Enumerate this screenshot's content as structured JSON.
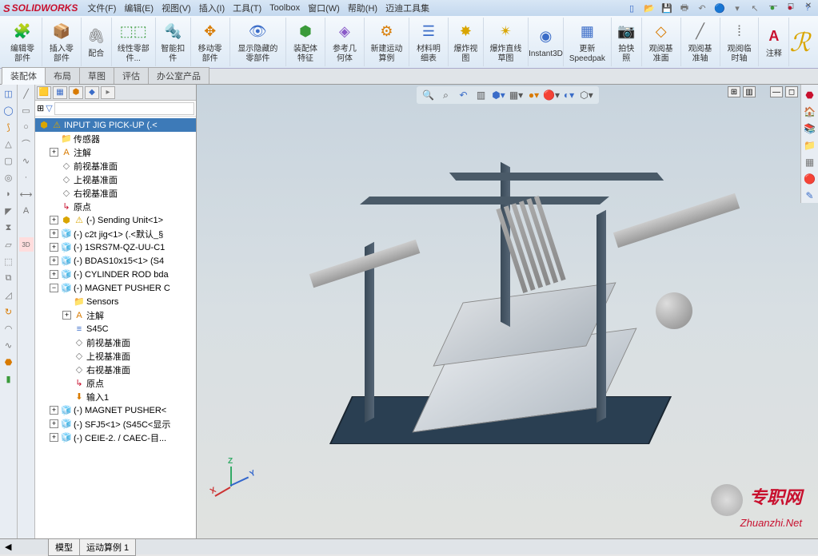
{
  "app": {
    "name": "SOLIDWORKS"
  },
  "menu": {
    "file": "文件(F)",
    "edit": "编辑(E)",
    "view": "视图(V)",
    "insert": "插入(I)",
    "tools": "工具(T)",
    "toolbox": "Toolbox",
    "window": "窗口(W)",
    "help": "帮助(H)",
    "maidi": "迈迪工具集"
  },
  "ribbon": {
    "editPart": "编辑零部件",
    "insertPart": "插入零部件",
    "mate": "配合",
    "linearPattern": "线性零部件...",
    "smartFastener": "智能扣件",
    "movePart": "移动零部件",
    "showHide": "显示隐藏的零部件",
    "assemblyFeature": "装配体特征",
    "referenceGeom": "参考几何体",
    "newMotion": "新建运动算例",
    "bom": "材料明细表",
    "explodeView": "爆炸视图",
    "explodeLine": "爆炸直线草图",
    "instant3d": "Instant3D",
    "speedpak": "更新Speedpak",
    "snapshot": "拍快照",
    "refPlane": "观阅基准面",
    "refAxis": "观阅基准轴",
    "tempAxis": "观阅临时轴",
    "annotation": "注释"
  },
  "tabs": {
    "assembly": "装配体",
    "layout": "布局",
    "sketch": "草图",
    "evaluate": "评估",
    "office": "办公室产品"
  },
  "tree": {
    "root": "INPUT JIG PICK-UP  (.<",
    "sensors": "传感器",
    "annotations": "注解",
    "frontPlane": "前视基准面",
    "topPlane": "上视基准面",
    "rightPlane": "右视基准面",
    "origin": "原点",
    "sendingUnit": "(-) Sending Unit<1>",
    "c2tjig": "(-) c2t jig<1> (.<默认_§",
    "srs": "(-) 1SRS7M-QZ-UU-C1",
    "bdas": "(-) BDAS10x15<1> (S4",
    "cylRod": "(-) CYLINDER ROD bda",
    "magnetPusher": "(-) MAGNET PUSHER C",
    "sensors2": "Sensors",
    "annotations2": "注解",
    "s45c": "S45C",
    "frontPlane2": "前视基准面",
    "topPlane2": "上视基准面",
    "rightPlane2": "右视基准面",
    "origin2": "原点",
    "input1": "输入1",
    "magnetPusher2": "(-) MAGNET PUSHER<",
    "sfj5": "(-) SFJ5<1> (S45C<显示",
    "sfie": "(-) CEIE-2. / CAEC-目..."
  },
  "bottomTabs": {
    "model": "模型",
    "motion": "运动算例 1"
  },
  "axes": {
    "x": "X",
    "y": "Y",
    "z": "Z"
  },
  "watermark": {
    "cn": "专职网",
    "url": "Zhuanzhi.Net"
  }
}
